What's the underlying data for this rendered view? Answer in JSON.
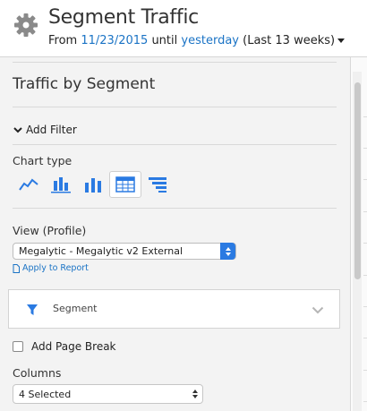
{
  "header": {
    "title": "Segment Traffic",
    "from_label": "From",
    "start_date": "11/23/2015",
    "until_label": "until",
    "end_date": "yesterday",
    "range_note": "(Last 13 weeks)"
  },
  "panel": {
    "section_title": "Traffic by Segment",
    "add_filter_label": "Add Filter",
    "chart_type_label": "Chart type",
    "chart_types": [
      "line-chart-icon",
      "stacked-bar-chart-icon",
      "bar-chart-icon",
      "table-icon",
      "horizontal-bar-chart-icon"
    ],
    "selected_chart_type": "table-icon",
    "view_label": "View (Profile)",
    "view_value": "Megalytic - Megalytic v2 External",
    "apply_label": "Apply to Report",
    "segment_label": "Segment",
    "page_break_label": "Add Page Break",
    "page_break_checked": false,
    "columns_label": "Columns",
    "columns_value": "4 Selected"
  },
  "colors": {
    "accent": "#1a73c5",
    "select_accent": "#2a7ae2",
    "panel_bg": "#f3f3f3"
  }
}
